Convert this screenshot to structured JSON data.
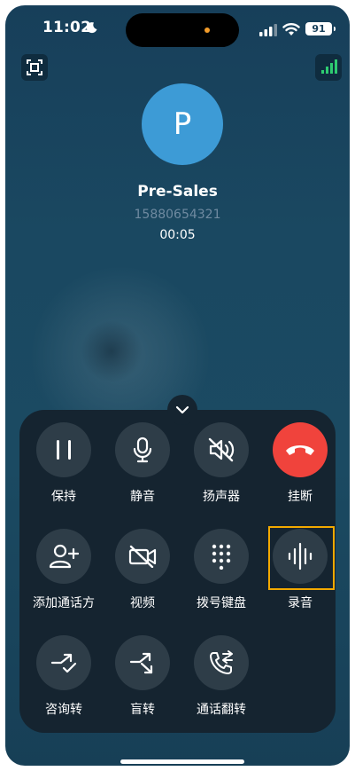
{
  "status_bar": {
    "time": "11:02",
    "battery": "91"
  },
  "call": {
    "avatar_initial": "P",
    "name": "Pre-Sales",
    "number": "15880654321",
    "duration": "00:05"
  },
  "controls": [
    {
      "label": "保持",
      "icon": "pause-icon"
    },
    {
      "label": "静音",
      "icon": "microphone-icon"
    },
    {
      "label": "扬声器",
      "icon": "speaker-muted-icon"
    },
    {
      "label": "挂断",
      "icon": "hang-up-icon"
    },
    {
      "label": "添加通话方",
      "icon": "add-person-icon"
    },
    {
      "label": "视频",
      "icon": "video-off-icon"
    },
    {
      "label": "拨号键盘",
      "icon": "dialpad-icon"
    },
    {
      "label": "录音",
      "icon": "sound-wave-icon"
    },
    {
      "label": "咨询转",
      "icon": "consult-transfer-icon"
    },
    {
      "label": "盲转",
      "icon": "blind-transfer-icon"
    },
    {
      "label": "通话翻转",
      "icon": "call-flip-icon"
    }
  ],
  "colors": {
    "background": "#1b4a62",
    "panel": "#152430",
    "button": "#2e3d48",
    "hang_up": "#f0433c",
    "avatar": "#3d9bd6",
    "highlight": "#f2a900"
  }
}
